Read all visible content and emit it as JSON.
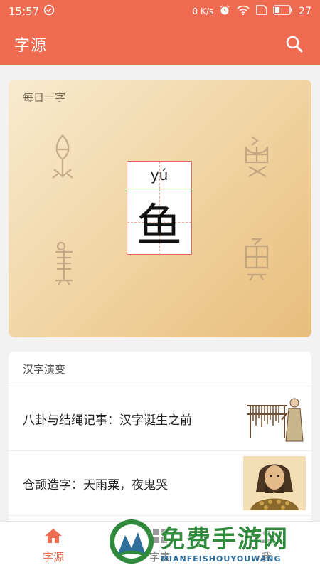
{
  "status_bar": {
    "time": "15:57",
    "network_speed": "0 K/s",
    "battery": "27"
  },
  "app_bar": {
    "title": "字源"
  },
  "daily_char": {
    "section_title": "每日一字",
    "pinyin": "yú",
    "character": "鱼",
    "ancient_forms": [
      "𩵋",
      "𩵋",
      "𩵋",
      "𩵋"
    ]
  },
  "evolution": {
    "section_title": "汉字演变",
    "articles": [
      {
        "title": "八卦与结绳记事：汉字诞生之前"
      },
      {
        "title": "仓颉造字：天雨粟，夜鬼哭"
      }
    ]
  },
  "tab_bar": {
    "tabs": [
      {
        "label": "字源",
        "icon": "home-icon",
        "active": true
      },
      {
        "label": "字表",
        "icon": "grid-icon",
        "active": false
      },
      {
        "label": "我",
        "icon": "person-icon",
        "active": false
      }
    ]
  },
  "watermark": {
    "main": "免费手游网",
    "sub": "MIANFEISHOUYOUWANG"
  },
  "colors": {
    "accent": "#ee6a50",
    "card_gold": "#e8bd7b",
    "watermark_green": "#2f8a3c"
  }
}
